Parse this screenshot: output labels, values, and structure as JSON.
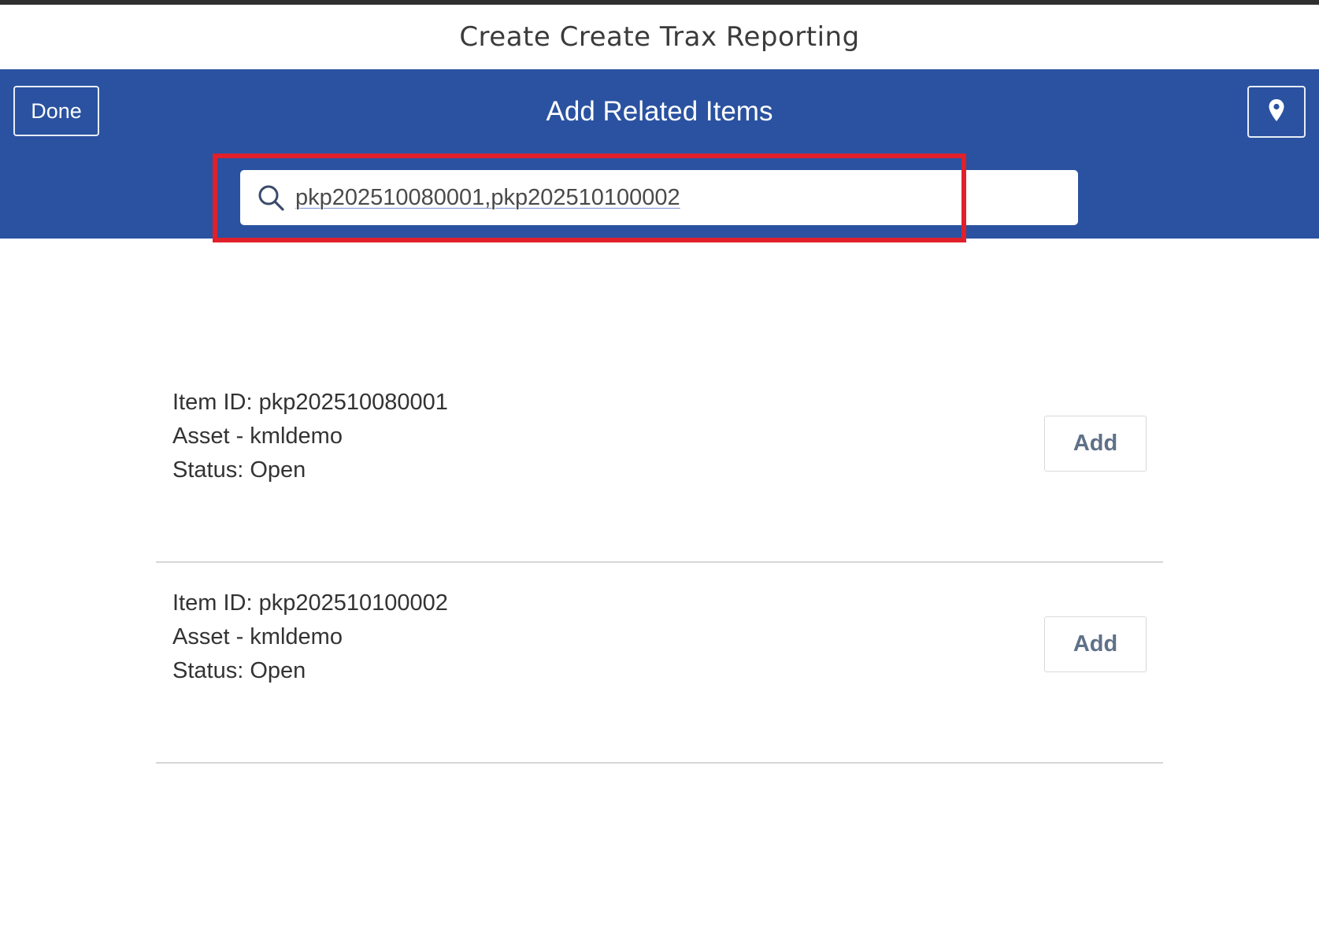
{
  "window": {
    "title": "Create Create Trax Reporting"
  },
  "header": {
    "done_label": "Done",
    "title": "Add Related Items",
    "location_icon": "map-pin-icon",
    "accent_color": "#2a52a0"
  },
  "search": {
    "value": "pkp202510080001,pkp202510100002",
    "icon": "search-icon"
  },
  "results": [
    {
      "item_id": "Item ID: pkp202510080001",
      "asset": "Asset - kmldemo",
      "status": "Status: Open",
      "add_label": "Add"
    },
    {
      "item_id": "Item ID: pkp202510100002",
      "asset": "Asset - kmldemo",
      "status": "Status: Open",
      "add_label": "Add"
    }
  ]
}
